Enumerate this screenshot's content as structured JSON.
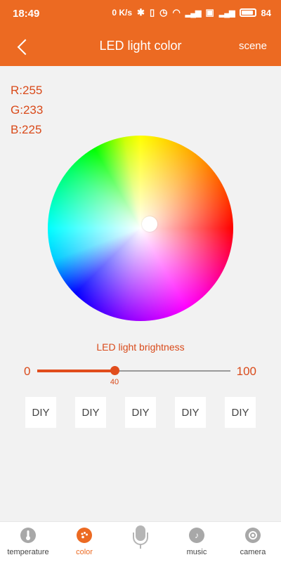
{
  "status_bar": {
    "time": "18:49",
    "net_speed": "0 K/s",
    "battery": "84"
  },
  "header": {
    "title": "LED light color",
    "scene_label": "scene",
    "back_icon": "chevron-left-icon"
  },
  "rgb": {
    "r": "R:255",
    "g": "G:233",
    "b": "B:225"
  },
  "brightness": {
    "label": "LED light brightness",
    "min": "0",
    "max": "100",
    "value": 40,
    "value_label": "40"
  },
  "diy_buttons": [
    "DIY",
    "DIY",
    "DIY",
    "DIY",
    "DIY"
  ],
  "tabs": [
    {
      "label": "temperature",
      "icon": "thermometer-icon",
      "active": false
    },
    {
      "label": "color",
      "icon": "palette-icon",
      "active": true
    },
    {
      "label": "",
      "icon": "microphone-icon",
      "active": false
    },
    {
      "label": "music",
      "icon": "music-note-icon",
      "active": false
    },
    {
      "label": "camera",
      "icon": "camera-icon",
      "active": false
    }
  ],
  "colors": {
    "accent": "#ec6a22",
    "text_accent": "#d94a1a",
    "background": "#f2f2f2"
  }
}
